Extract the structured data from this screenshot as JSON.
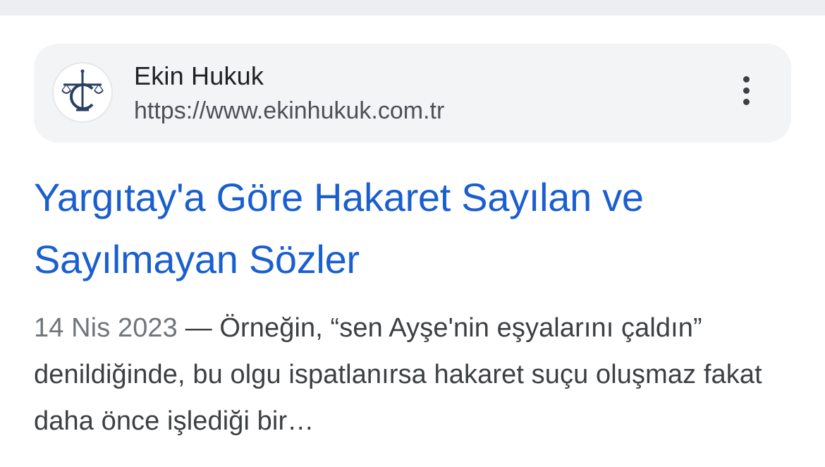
{
  "source": {
    "site_name": "Ekin Hukuk",
    "url": "https://www.ekinhukuk.com.tr",
    "favicon_icon": "scales-of-justice-logo",
    "more_icon": "more-vert-icon"
  },
  "result": {
    "title": "Yargıtay'a Göre Hakaret Sayılan ve Sayılmayan Sözler",
    "date": "14 Nis 2023",
    "separator": " — ",
    "snippet": "Örneğin, “sen Ayşe'nin eşyalarını çaldın” denildiğinde, bu olgu ispatlanırsa hakaret suçu oluşmaz fakat daha önce işlediği bir…"
  },
  "colors": {
    "title_link": "#1a5fcf",
    "card_background": "#f3f4f6"
  }
}
